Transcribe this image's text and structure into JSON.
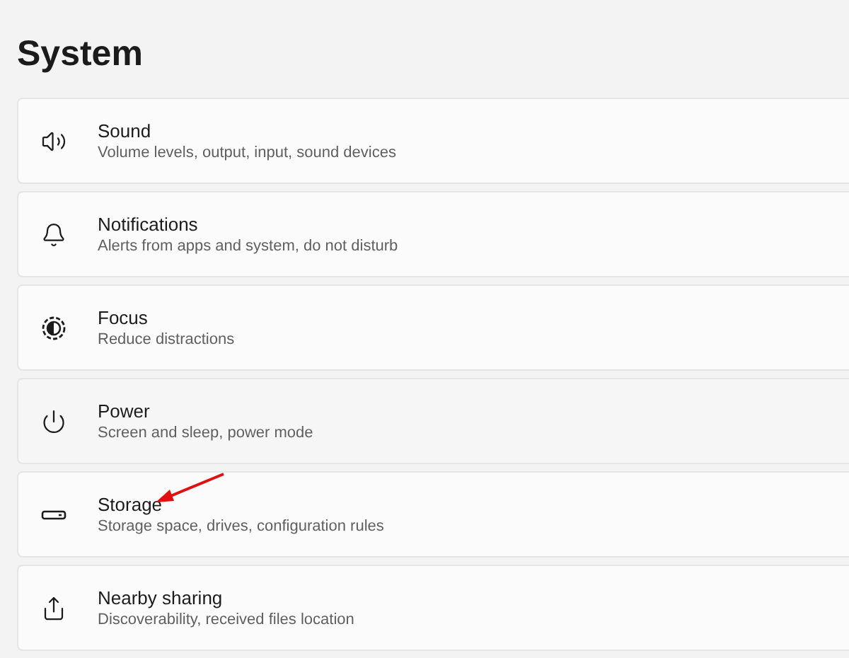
{
  "page_title": "System",
  "items": [
    {
      "title": "Sound",
      "subtitle": "Volume levels, output, input, sound devices",
      "hovered": false,
      "pointed": false
    },
    {
      "title": "Notifications",
      "subtitle": "Alerts from apps and system, do not disturb",
      "hovered": false,
      "pointed": false
    },
    {
      "title": "Focus",
      "subtitle": "Reduce distractions",
      "hovered": false,
      "pointed": false
    },
    {
      "title": "Power",
      "subtitle": "Screen and sleep, power mode",
      "hovered": true,
      "pointed": false
    },
    {
      "title": "Storage",
      "subtitle": "Storage space, drives, configuration rules",
      "hovered": false,
      "pointed": true
    },
    {
      "title": "Nearby sharing",
      "subtitle": "Discoverability, received files location",
      "hovered": false,
      "pointed": false
    }
  ]
}
